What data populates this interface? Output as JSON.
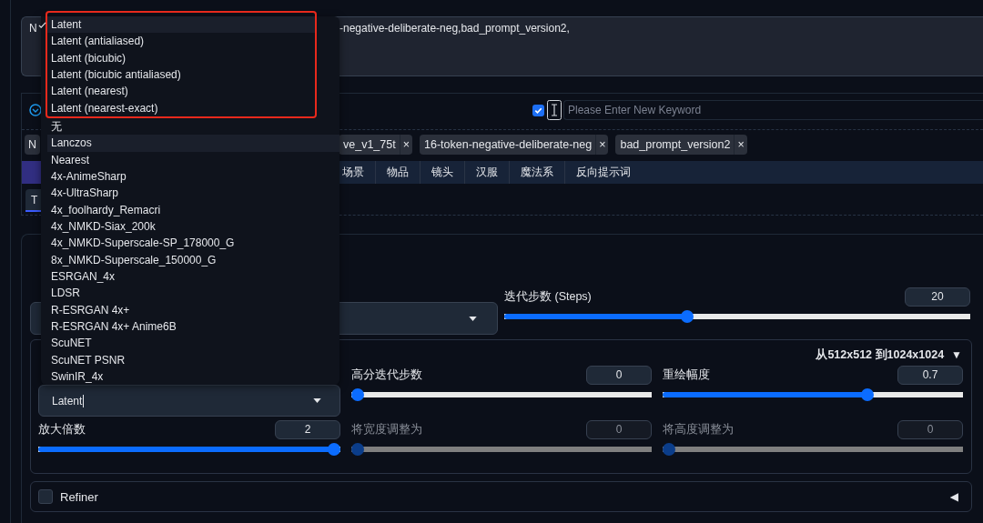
{
  "prompt": {
    "start": "N",
    "end": "-negative-deliberate-neg,bad_prompt_version2,"
  },
  "keyword": {
    "checked": true,
    "placeholder": "Please Enter New Keyword"
  },
  "tags": [
    {
      "kind": "fragment",
      "label": "N"
    },
    {
      "kind": "tag",
      "label": "ve_v1_75t",
      "close": "×"
    },
    {
      "kind": "tag",
      "label": "16-token-negative-deliberate-neg",
      "close": "×"
    },
    {
      "kind": "tag",
      "label": "bad_prompt_version2",
      "close": "×"
    }
  ],
  "tabs": [
    {
      "kind": "fragment",
      "selected": true
    },
    {
      "kind": "tab",
      "label": "场景",
      "selected": false
    },
    {
      "kind": "tab",
      "label": "物品",
      "selected": false
    },
    {
      "kind": "tab",
      "label": "镜头",
      "selected": false
    },
    {
      "kind": "tab",
      "label": "汉服",
      "selected": false
    },
    {
      "kind": "tab",
      "label": "魔法系",
      "selected": false
    },
    {
      "kind": "tab",
      "label": "反向提示词",
      "selected": false
    }
  ],
  "subtabs": [
    {
      "label": "T",
      "selected": true
    }
  ],
  "steps": {
    "label": "迭代步数 (Steps)",
    "value": "20",
    "level": 0.39
  },
  "hires": {
    "summary": "从512x512 到1024x1024",
    "arrow": "▼",
    "cells": [
      {
        "kind": "select",
        "value": "Latent"
      },
      {
        "kind": "slider",
        "label": "高分迭代步数",
        "value": "0",
        "level": 0,
        "disabled": false
      },
      {
        "kind": "slider",
        "label": "重绘幅度",
        "value": "0.7",
        "level": 0.69,
        "disabled": false
      },
      {
        "kind": "slider",
        "label": "放大倍数",
        "value": "2",
        "level": 1,
        "disabled": false
      },
      {
        "kind": "slider",
        "label": "将宽度调整为",
        "value": "0",
        "level": 0,
        "disabled": true
      },
      {
        "kind": "slider",
        "label": "将高度调整为",
        "value": "0",
        "level": 0,
        "disabled": true
      }
    ]
  },
  "refiner": {
    "label": "Refiner",
    "checked": false,
    "arrow": "◀"
  },
  "dropdown": {
    "highlighted_options": [
      {
        "label": "Latent",
        "selected": true,
        "hovered": true
      },
      {
        "label": "Latent (antialiased)",
        "selected": false,
        "hovered": false
      },
      {
        "label": "Latent (bicubic)",
        "selected": false,
        "hovered": false
      },
      {
        "label": "Latent (bicubic antialiased)",
        "selected": false,
        "hovered": false
      },
      {
        "label": "Latent (nearest)",
        "selected": false,
        "hovered": false
      },
      {
        "label": "Latent (nearest-exact)",
        "selected": false,
        "hovered": false
      }
    ],
    "options": [
      {
        "label": "无",
        "selected": false,
        "hovered": false
      },
      {
        "label": "Lanczos",
        "selected": false,
        "hovered": true
      },
      {
        "label": "Nearest",
        "selected": false,
        "hovered": false
      },
      {
        "label": "4x-AnimeSharp",
        "selected": false,
        "hovered": false
      },
      {
        "label": "4x-UltraSharp",
        "selected": false,
        "hovered": false
      },
      {
        "label": "4x_foolhardy_Remacri",
        "selected": false,
        "hovered": false
      },
      {
        "label": "4x_NMKD-Siax_200k",
        "selected": false,
        "hovered": false
      },
      {
        "label": "4x_NMKD-Superscale-SP_178000_G",
        "selected": false,
        "hovered": false
      },
      {
        "label": "8x_NMKD-Superscale_150000_G",
        "selected": false,
        "hovered": false
      },
      {
        "label": "ESRGAN_4x",
        "selected": false,
        "hovered": false
      },
      {
        "label": "LDSR",
        "selected": false,
        "hovered": false
      },
      {
        "label": "R-ESRGAN 4x+",
        "selected": false,
        "hovered": false
      },
      {
        "label": "R-ESRGAN 4x+ Anime6B",
        "selected": false,
        "hovered": false
      },
      {
        "label": "ScuNET",
        "selected": false,
        "hovered": false
      },
      {
        "label": "ScuNET PSNR",
        "selected": false,
        "hovered": false
      },
      {
        "label": "SwinIR_4x",
        "selected": false,
        "hovered": false
      }
    ]
  }
}
